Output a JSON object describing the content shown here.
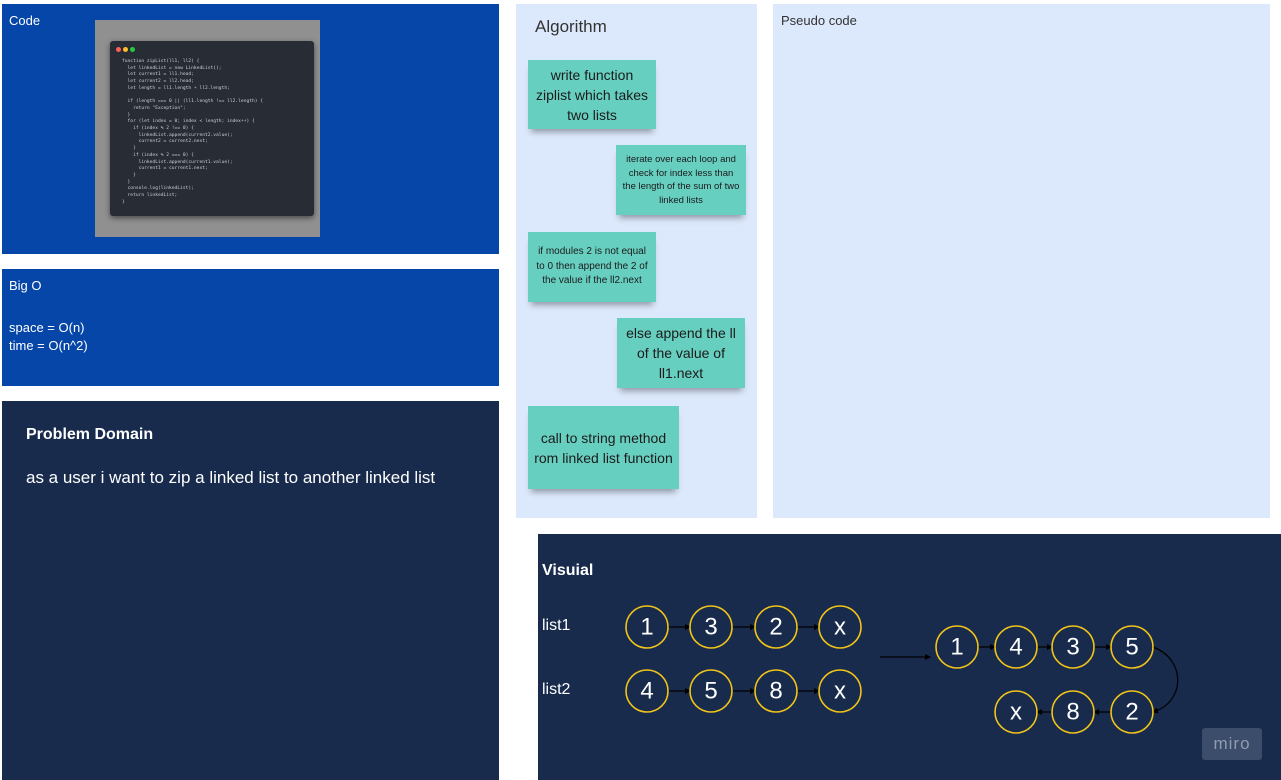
{
  "code_frame": {
    "title": "Code",
    "code_lines": [
      "function zipList(ll1, ll2) {",
      "  let linkedList = new LinkedList();",
      "  let current1 = ll1.head;",
      "  let current2 = ll2.head;",
      "  let length = ll1.length + ll2.length;",
      "",
      "  if (length === 0 || (ll1.length !== ll2.length) {",
      "    return \"Exception\";",
      "  }",
      "  for (let index = 0; index < length; index++) {",
      "    if (index % 2 !== 0) {",
      "      linkedList.append(current2.value);",
      "      current2 = current2.next;",
      "    }",
      "    if (index % 2 === 0) {",
      "      linkedList.append(current1.value);",
      "      current1 = current1.next;",
      "    }",
      "  }",
      "  console.log(linkedList);",
      "  return linkedList;",
      "}"
    ],
    "window_dots": [
      "#ff5f56",
      "#ffbd2e",
      "#27c93f"
    ]
  },
  "bigo_frame": {
    "title": "Big O",
    "space": "space = O(n)",
    "time": "time = O(n^2)"
  },
  "problem_frame": {
    "title": "Problem Domain",
    "text": "as a user i want to zip a linked list to another linked list"
  },
  "algorithm_frame": {
    "title": "Algorithm",
    "notes": [
      "write function ziplist which takes two lists",
      "iterate over each loop and check for index less than the length of the sum of two linked lists",
      "if modules 2 is not equal to 0 then append the 2 of the value if the ll2.next",
      "else append the ll of the value of ll1.next",
      "call to string method rom linked list function"
    ]
  },
  "pseudo_frame": {
    "title": "Pseudo code"
  },
  "visual_frame": {
    "title": "Visuial",
    "list1_label": "list1",
    "list2_label": "list2",
    "list1": [
      "1",
      "3",
      "2",
      "x"
    ],
    "list2": [
      "4",
      "5",
      "8",
      "x"
    ],
    "result_top": [
      "1",
      "4",
      "3",
      "5"
    ],
    "result_bottom": [
      "x",
      "8",
      "2"
    ]
  },
  "branding": {
    "logo": "miro"
  },
  "colors": {
    "blue_frame": "#0546a8",
    "navy_frame": "#182b4d",
    "light_frame": "#dce8fb",
    "sticky_note": "#67cfc0",
    "node_stroke": "#f0c419"
  }
}
